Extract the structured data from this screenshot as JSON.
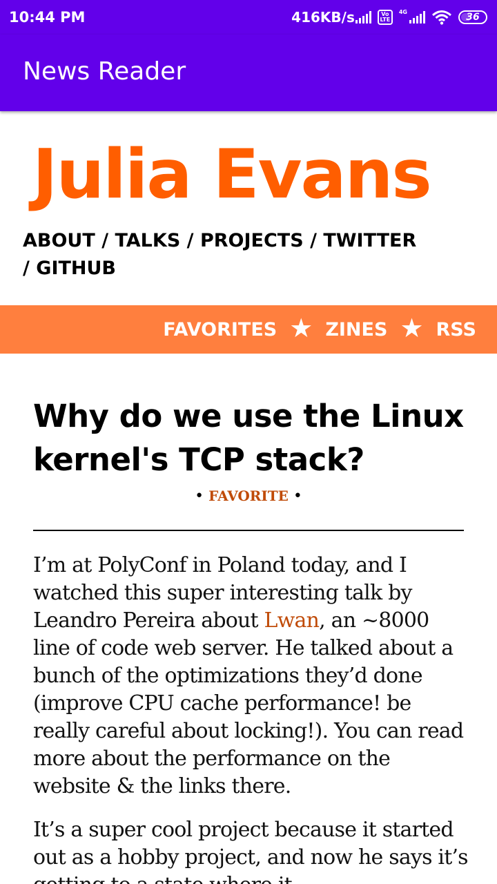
{
  "status_bar": {
    "time": "10:44 PM",
    "network_speed": "416KB/s",
    "volte_label_top": "Vo",
    "volte_label_bottom": "LTE",
    "network_type": "4G",
    "battery_level": "36"
  },
  "app_bar": {
    "title": "News Reader"
  },
  "site": {
    "title": "Julia Evans",
    "nav": [
      {
        "label": "ABOUT"
      },
      {
        "label": "TALKS"
      },
      {
        "label": "PROJECTS"
      },
      {
        "label": "TWITTER"
      },
      {
        "label": "GITHUB"
      }
    ],
    "nav_separator": "/",
    "links_bar": [
      {
        "label": "FAVORITES"
      },
      {
        "label": "ZINES"
      },
      {
        "label": "RSS"
      }
    ],
    "links_separator": "★"
  },
  "post": {
    "title": "Why do we use the Linux kernel's TCP stack?",
    "tag_bullet": "•",
    "tag": "FAVORITE",
    "paragraph1": {
      "before_link": "I’m at PolyConf in Poland today, and I watched this super interesting talk by Leandro Pereira about ",
      "link": "Lwan",
      "after_link": ", an ~8000 line of code web server. He talked about a bunch of the optimizations they’d done (improve CPU cache performance! be really careful about locking!). You can read more about the performance on the website & the links there."
    },
    "paragraph2": "It’s a super cool project because it started out as a hobby project, and now he says it’s getting to a state where it"
  },
  "colors": {
    "app_bar": "#6200ea",
    "site_title": "#ff5e00",
    "links_bar": "#ff7f3e",
    "link": "#c04b08"
  }
}
